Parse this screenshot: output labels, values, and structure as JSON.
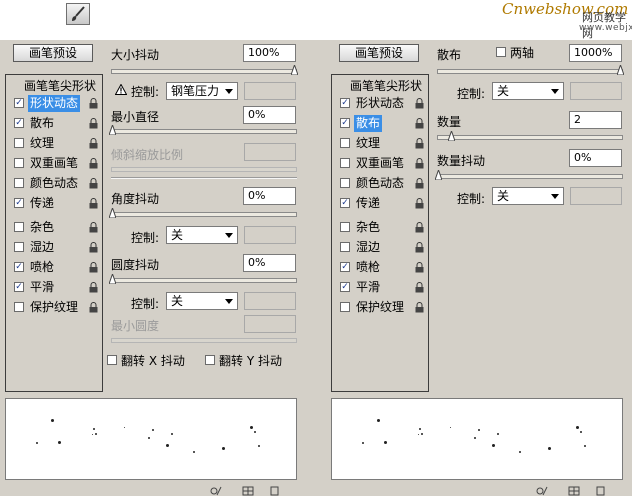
{
  "brand": {
    "logo": "Cnwebshow.com",
    "sub_cn": "网页教学网",
    "sub_url": "www.webjx.com"
  },
  "icons": {
    "brush": "brush-icon",
    "lock": "lock-icon",
    "warning": "warning-icon",
    "new_preset": "new-preset-icon",
    "grid": "grid-icon",
    "page": "page-icon"
  },
  "colors": {
    "selection": "#3a8ee6",
    "panel_bg": "#d4d0c8"
  },
  "left": {
    "preset_btn": "画笔预设",
    "list_header": "画笔笔尖形状",
    "items": [
      {
        "label": "形状动态",
        "checked": true
      },
      {
        "label": "散布",
        "checked": true
      },
      {
        "label": "纹理",
        "checked": false
      },
      {
        "label": "双重画笔",
        "checked": false
      },
      {
        "label": "颜色动态",
        "checked": false
      },
      {
        "label": "传递",
        "checked": true
      },
      {
        "label": "杂色",
        "checked": false
      },
      {
        "label": "湿边",
        "checked": false
      },
      {
        "label": "喷枪",
        "checked": true
      },
      {
        "label": "平滑",
        "checked": true
      },
      {
        "label": "保护纹理",
        "checked": false
      }
    ],
    "size_jitter": {
      "label": "大小抖动",
      "value": "100%"
    },
    "control1": {
      "label": "控制:",
      "value": "钢笔压力"
    },
    "min_diameter": {
      "label": "最小直径",
      "value": "0%"
    },
    "tilt_scale": {
      "label": "倾斜缩放比例"
    },
    "angle_jitter": {
      "label": "角度抖动",
      "value": "0%"
    },
    "control2": {
      "label": "控制:",
      "value": "关"
    },
    "roundness_jitter": {
      "label": "圆度抖动",
      "value": "0%"
    },
    "control3": {
      "label": "控制:",
      "value": "关"
    },
    "min_roundness": {
      "label": "最小圆度"
    },
    "flip_x": {
      "label": "翻转 X 抖动"
    },
    "flip_y": {
      "label": "翻转 Y 抖动"
    }
  },
  "right": {
    "preset_btn": "画笔预设",
    "list_header": "画笔笔尖形状",
    "items": [
      {
        "label": "形状动态",
        "checked": true
      },
      {
        "label": "散布",
        "checked": true
      },
      {
        "label": "纹理",
        "checked": false
      },
      {
        "label": "双重画笔",
        "checked": false
      },
      {
        "label": "颜色动态",
        "checked": false
      },
      {
        "label": "传递",
        "checked": true
      },
      {
        "label": "杂色",
        "checked": false
      },
      {
        "label": "湿边",
        "checked": false
      },
      {
        "label": "喷枪",
        "checked": true
      },
      {
        "label": "平滑",
        "checked": true
      },
      {
        "label": "保护纹理",
        "checked": false
      }
    ],
    "scatter": {
      "label": "散布",
      "value": "1000%"
    },
    "both_axes": {
      "label": "两轴"
    },
    "control1": {
      "label": "控制:",
      "value": "关"
    },
    "count": {
      "label": "数量",
      "value": "2"
    },
    "count_jitter": {
      "label": "数量抖动",
      "value": "0%"
    },
    "control2": {
      "label": "控制:",
      "value": "关"
    }
  }
}
